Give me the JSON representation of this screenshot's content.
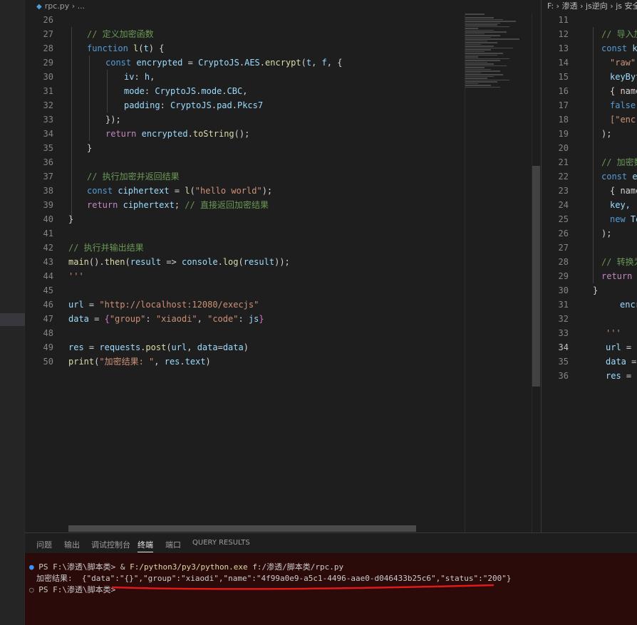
{
  "left_tab": {
    "icon": "python-file-icon",
    "label": "rpc.py",
    "ellipsis": "..."
  },
  "right_breadcrumb": [
    "F:",
    "渗透",
    "js逆向",
    "js 安全"
  ],
  "left_lines": [
    {
      "n": "26",
      "t": ""
    },
    {
      "n": "27",
      "t": "// 定义加密函数"
    },
    {
      "n": "28",
      "t": "function l(t) {"
    },
    {
      "n": "29",
      "t": "const encrypted = CryptoJS.AES.encrypt(t, f, {"
    },
    {
      "n": "30",
      "t": "iv: h,"
    },
    {
      "n": "31",
      "t": "mode: CryptoJS.mode.CBC,"
    },
    {
      "n": "32",
      "t": "padding: CryptoJS.pad.Pkcs7"
    },
    {
      "n": "33",
      "t": "});"
    },
    {
      "n": "34",
      "t": "return encrypted.toString();"
    },
    {
      "n": "35",
      "t": "}"
    },
    {
      "n": "36",
      "t": ""
    },
    {
      "n": "37",
      "t": "// 执行加密并返回结果"
    },
    {
      "n": "38",
      "t": "const ciphertext = l(\"hello world\");"
    },
    {
      "n": "39",
      "t": "return ciphertext; // 直接返回加密结果"
    },
    {
      "n": "40",
      "t": "}"
    },
    {
      "n": "41",
      "t": ""
    },
    {
      "n": "42",
      "t": "// 执行并输出结果"
    },
    {
      "n": "43",
      "t": "main().then(result => console.log(result));"
    },
    {
      "n": "44",
      "t": "'''"
    },
    {
      "n": "45",
      "t": ""
    },
    {
      "n": "46",
      "t": "url = \"http://localhost:12080/execjs\""
    },
    {
      "n": "47",
      "t": "data = {\"group\": \"xiaodi\", \"code\": js}"
    },
    {
      "n": "48",
      "t": ""
    },
    {
      "n": "49",
      "t": "res = requests.post(url, data=data)"
    },
    {
      "n": "50",
      "t": "print(\"加密结果: \", res.text)"
    }
  ],
  "right_lines": [
    {
      "n": "11",
      "t": ""
    },
    {
      "n": "12",
      "t": "// 导入加"
    },
    {
      "n": "13",
      "t": "const ke"
    },
    {
      "n": "14",
      "t": "\"raw\","
    },
    {
      "n": "15",
      "t": "keyByt"
    },
    {
      "n": "16",
      "t": "{ name"
    },
    {
      "n": "17",
      "t": "false,"
    },
    {
      "n": "18",
      "t": "[\"encr"
    },
    {
      "n": "19",
      "t": ");"
    },
    {
      "n": "20",
      "t": ""
    },
    {
      "n": "21",
      "t": "// 加密数"
    },
    {
      "n": "22",
      "t": "const en"
    },
    {
      "n": "23",
      "t": "{ name"
    },
    {
      "n": "24",
      "t": "key,"
    },
    {
      "n": "25",
      "t": "new Te"
    },
    {
      "n": "26",
      "t": ");"
    },
    {
      "n": "27",
      "t": ""
    },
    {
      "n": "28",
      "t": "// 转换为"
    },
    {
      "n": "29",
      "t": "return b"
    },
    {
      "n": "30",
      "t": "}"
    },
    {
      "n": "31",
      "t": "encr"
    },
    {
      "n": "32",
      "t": ""
    },
    {
      "n": "33",
      "t": "'''"
    },
    {
      "n": "34",
      "t": "url = \""
    },
    {
      "n": "35",
      "t": "data ="
    },
    {
      "n": "36",
      "t": "res = r"
    }
  ],
  "panel_tabs": [
    "问题",
    "输出",
    "调试控制台",
    "终端",
    "端口",
    "QUERY RESULTS"
  ],
  "panel_active_tab": "终端",
  "terminal": {
    "line1_prompt": "PS F:\\渗透\\脚本类>",
    "line1_amp": "&",
    "line1_exe": "F:/python3/py3/python.exe",
    "line1_arg": "f:/渗透/脚本类/rpc.py",
    "line2_label": "加密结果: ",
    "line2_json": "{\"data\":\"{}\",\"group\":\"xiaodi\",\"name\":\"4f99a0e9-a5c1-4496-aae0-d046433b25c6\",\"status\":\"200\"}",
    "line3_prompt": "PS F:\\渗透\\脚本类>"
  },
  "colors": {
    "terminal_bg": "#2b0a0a",
    "annotation_red": "#e0191a",
    "accent_blue": "#3794ff"
  }
}
